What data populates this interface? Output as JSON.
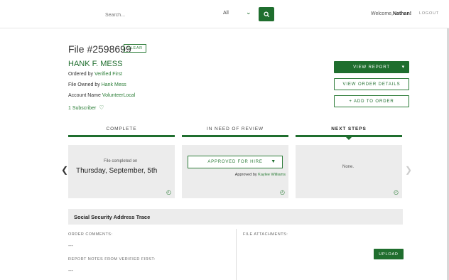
{
  "header": {
    "search_placeholder": "Search...",
    "filter_value": "All",
    "welcome_prefix": "Welcome,",
    "user_name": "Nathan!",
    "logout_label": "LOGOUT"
  },
  "file": {
    "title": "File #2598699",
    "clear_label": "CLEAR",
    "client_name": "HANK F. MESS",
    "ordered_by_label": "Ordered by",
    "ordered_by_value": "Verified First",
    "owned_by_label": "File Owned by",
    "owned_by_value": "Hank Mess",
    "account_label": "Account Name",
    "account_value": "VolunteerLocal",
    "subscriber_label": "1 Subscriber"
  },
  "actions": {
    "view_report": "VIEW REPORT",
    "view_order_details": "VIEW ORDER DETAILS",
    "add_to_order": "+ ADD TO ORDER"
  },
  "columns": [
    {
      "label": "COMPLETE"
    },
    {
      "label": "IN NEED OF REVIEW"
    },
    {
      "label": "NEXT STEPS"
    }
  ],
  "panels": {
    "complete_small": "File completed on",
    "complete_date": "Thursday, September, 5th",
    "review_status": "APPROVED FOR HIRE",
    "approved_by_label": "Approved by",
    "approved_by_value": "Kaylee Williams",
    "next_steps_value": "None."
  },
  "section": {
    "title": "Social Security Address Trace",
    "order_comments_label": "ORDER COMMENTS:",
    "order_comments_value": "---",
    "report_notes_label": "REPORT NOTES FROM VERIFIED FIRST:",
    "report_notes_value": "---",
    "file_attachments_label": "FILE ATTACHMENTS:",
    "upload_label": "UPLOAD"
  },
  "colors": {
    "brand_green": "#1f6e2e",
    "link_green": "#2a7d36",
    "panel_gray": "#ececec"
  },
  "icons": {
    "search": "search-icon",
    "chevron": "chevron-down-icon",
    "bell": "bell-icon",
    "clock": "clock-icon",
    "arrow_left": "chevron-left-icon",
    "arrow_right": "chevron-right-icon"
  }
}
